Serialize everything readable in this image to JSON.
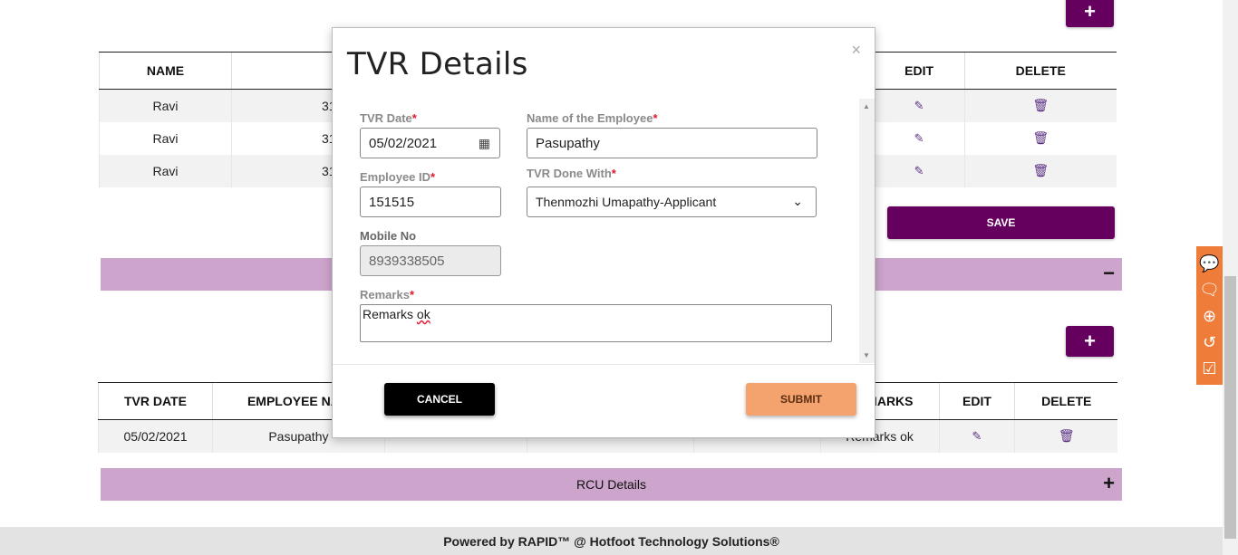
{
  "top_table": {
    "headers": [
      "NAME",
      "",
      "EDIT",
      "DELETE"
    ],
    "rows": [
      {
        "name": "Ravi",
        "col2": "31"
      },
      {
        "name": "Ravi",
        "col2": "31"
      },
      {
        "name": "Ravi",
        "col2": "31"
      }
    ],
    "save_label": "SAVE"
  },
  "tvr_table": {
    "headers": [
      "TVR DATE",
      "EMPLOYEE NA",
      "",
      "",
      "",
      "MARKS",
      "EDIT",
      "DELETE"
    ],
    "row": {
      "date": "05/02/2021",
      "employee": "Pasupathy",
      "remarks": "Remarks ok"
    }
  },
  "sections": {
    "rcu_title": "RCU Details",
    "toggle_minus": "−",
    "toggle_plus": "+"
  },
  "footer": {
    "text": "Powered by RAPID™ @ Hotfoot Technology Solutions®"
  },
  "modal": {
    "title": "TVR Details",
    "close": "×",
    "fields": {
      "tvr_date_label": "TVR Date",
      "tvr_date_value": "05/02/2021",
      "employee_name_label": "Name of the Employee",
      "employee_name_value": "Pasupathy",
      "employee_id_label": "Employee ID",
      "employee_id_value": "151515",
      "tvr_done_with_label": "TVR Done With",
      "tvr_done_with_value": "Thenmozhi Umapathy-Applicant",
      "mobile_label": "Mobile No",
      "mobile_value": "8939338505",
      "remarks_label": "Remarks",
      "remarks_word1": "Remarks",
      "remarks_word2": "ok"
    },
    "required_mark": "*",
    "cancel_label": "CANCEL",
    "submit_label": "SUBMIT"
  },
  "icons": {
    "plus": "plus-icon",
    "edit": "edit-icon",
    "delete": "trash-icon",
    "calendar": "calendar-icon",
    "chevron": "chevron-down-icon"
  },
  "colors": {
    "brand_purple": "#66005f",
    "section_bar": "#cda4cc",
    "submit": "#f5a36e",
    "side_tools": "#f07c3a"
  }
}
